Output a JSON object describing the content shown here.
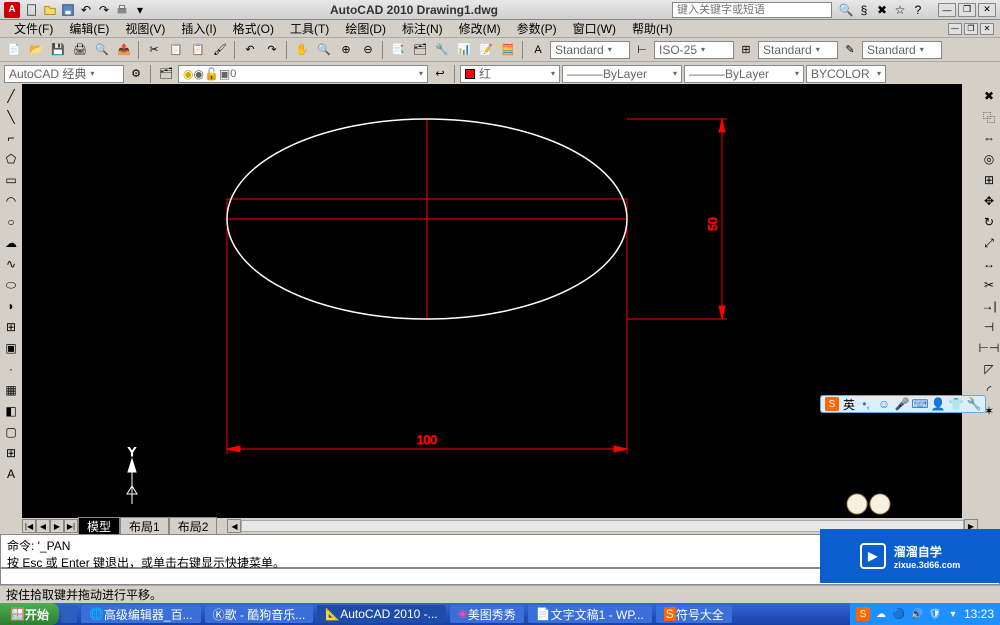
{
  "app": {
    "title": "AutoCAD 2010  Drawing1.dwg",
    "logo_letter": "A"
  },
  "title_input_placeholder": "键入关键字或短语",
  "menubar": {
    "items": [
      "文件(F)",
      "编辑(E)",
      "视图(V)",
      "插入(I)",
      "格式(O)",
      "工具(T)",
      "绘图(D)",
      "标注(N)",
      "修改(M)",
      "参数(P)",
      "窗口(W)",
      "帮助(H)"
    ]
  },
  "toolbar2": {
    "workspace": "AutoCAD 经典",
    "style1": "Standard",
    "style2": "ISO-25",
    "style3": "Standard",
    "style4": "Standard"
  },
  "toolbar3": {
    "color_label": "红",
    "layer": "ByLayer",
    "linetype": "ByLayer",
    "lineweight": "BYCOLOR"
  },
  "tabs": {
    "model": "模型",
    "layout1": "布局1",
    "layout2": "布局2"
  },
  "drawing": {
    "dim_width": "100",
    "dim_height": "50",
    "ucs_y": "Y"
  },
  "command": {
    "line1": "命令: '_PAN",
    "line2": "按 Esc 或 Enter 键退出，或单击右键显示快捷菜单。",
    "status": "按住拾取键并拖动进行平移。"
  },
  "taskbar": {
    "start": "开始",
    "items": [
      "高级编辑器_百...",
      "歌 - 酷狗音乐...",
      "AutoCAD 2010 -...",
      "美图秀秀",
      "文字文稿1 - WP...",
      "符号大全"
    ],
    "time": "13:23"
  },
  "watermark": {
    "main": "溜溜自学",
    "sub": "zixue.3d66.com"
  },
  "ime": {
    "lang": "英"
  }
}
